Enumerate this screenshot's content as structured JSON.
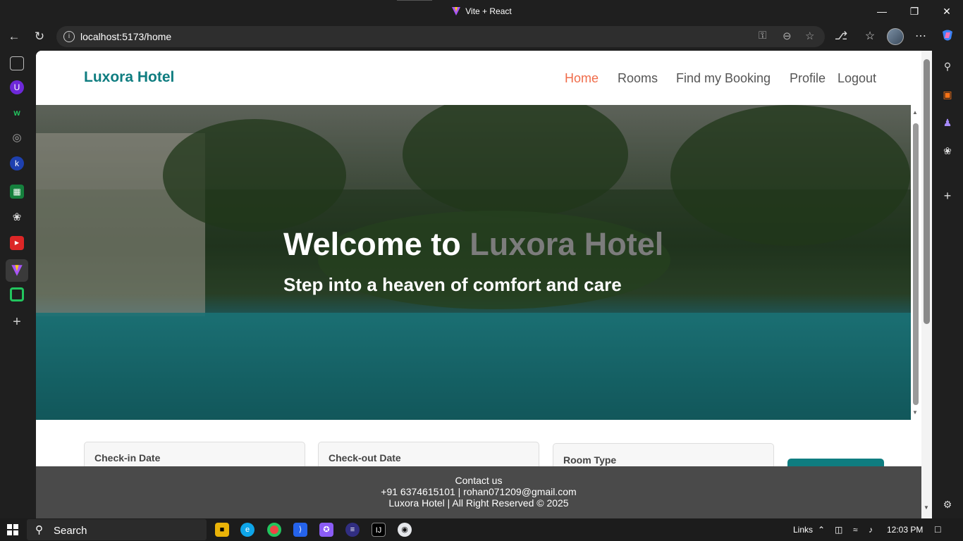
{
  "browser": {
    "tab_title": "Vite + React",
    "url": "localhost:5173/home"
  },
  "site": {
    "brand": "Luxora Hotel",
    "nav": [
      {
        "label": "Home",
        "active": true
      },
      {
        "label": "Rooms",
        "active": false
      },
      {
        "label": "Find my Booking",
        "active": false
      },
      {
        "label": "Profile",
        "active": false
      },
      {
        "label": "Logout",
        "active": false
      }
    ],
    "hero": {
      "title_prefix": "Welcome to ",
      "title_accent": "Luxora Hotel",
      "subtitle": "Step into a heaven of comfort and care"
    },
    "search": {
      "checkin_label": "Check-in Date",
      "checkout_label": "Check-out Date",
      "room_type_label": "Room Type"
    },
    "footer": {
      "heading": "Contact us",
      "contact": "+91 6374615101 | rohan071209@gmail.com",
      "copyright": "Luxora Hotel | All Right Reserved © 2025"
    }
  },
  "taskbar": {
    "search_placeholder": "Search",
    "links_label": "Links",
    "time": "12:03 PM"
  },
  "colors": {
    "brand": "#0f7d80",
    "nav_active": "#f06c4a",
    "footer_bg": "#4a4a4a"
  }
}
